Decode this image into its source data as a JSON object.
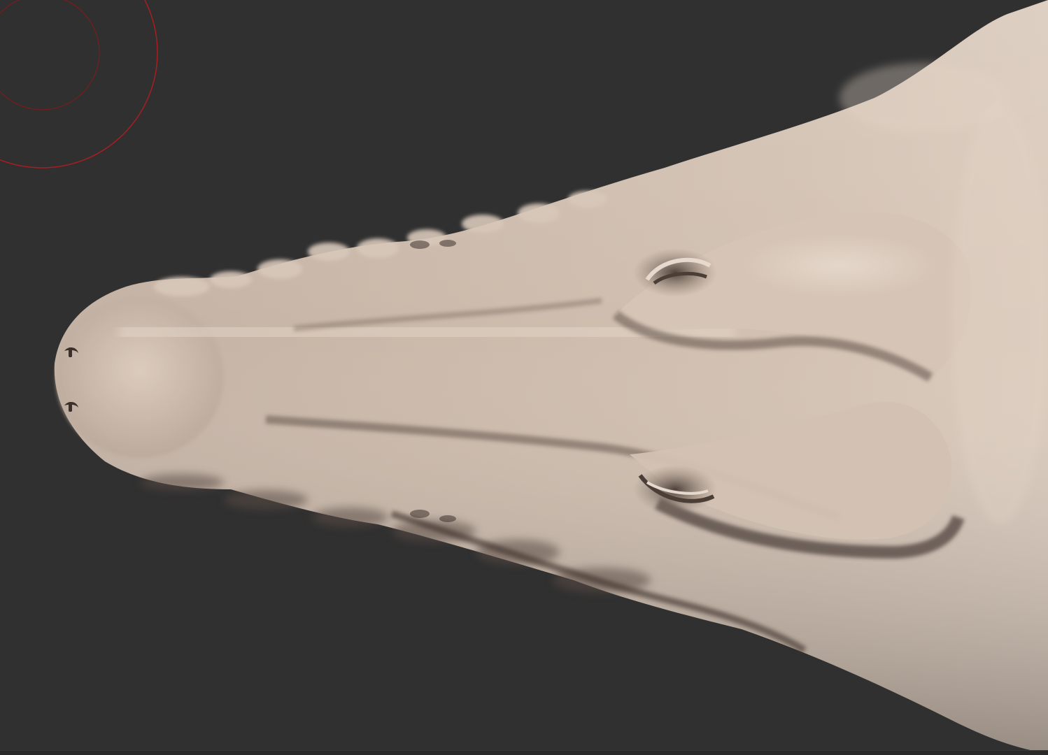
{
  "viewport": {
    "background_color": "#303030",
    "model": {
      "subject": "crocodile-head-sculpt",
      "material_color": "#c9b8a9",
      "highlight_color": "#e4d6c9",
      "shadow_color": "#6d5d52"
    },
    "brush_cursor": {
      "outer_ring_color": "#a81e22",
      "inner_ring_color": "#7a1c1e"
    }
  }
}
